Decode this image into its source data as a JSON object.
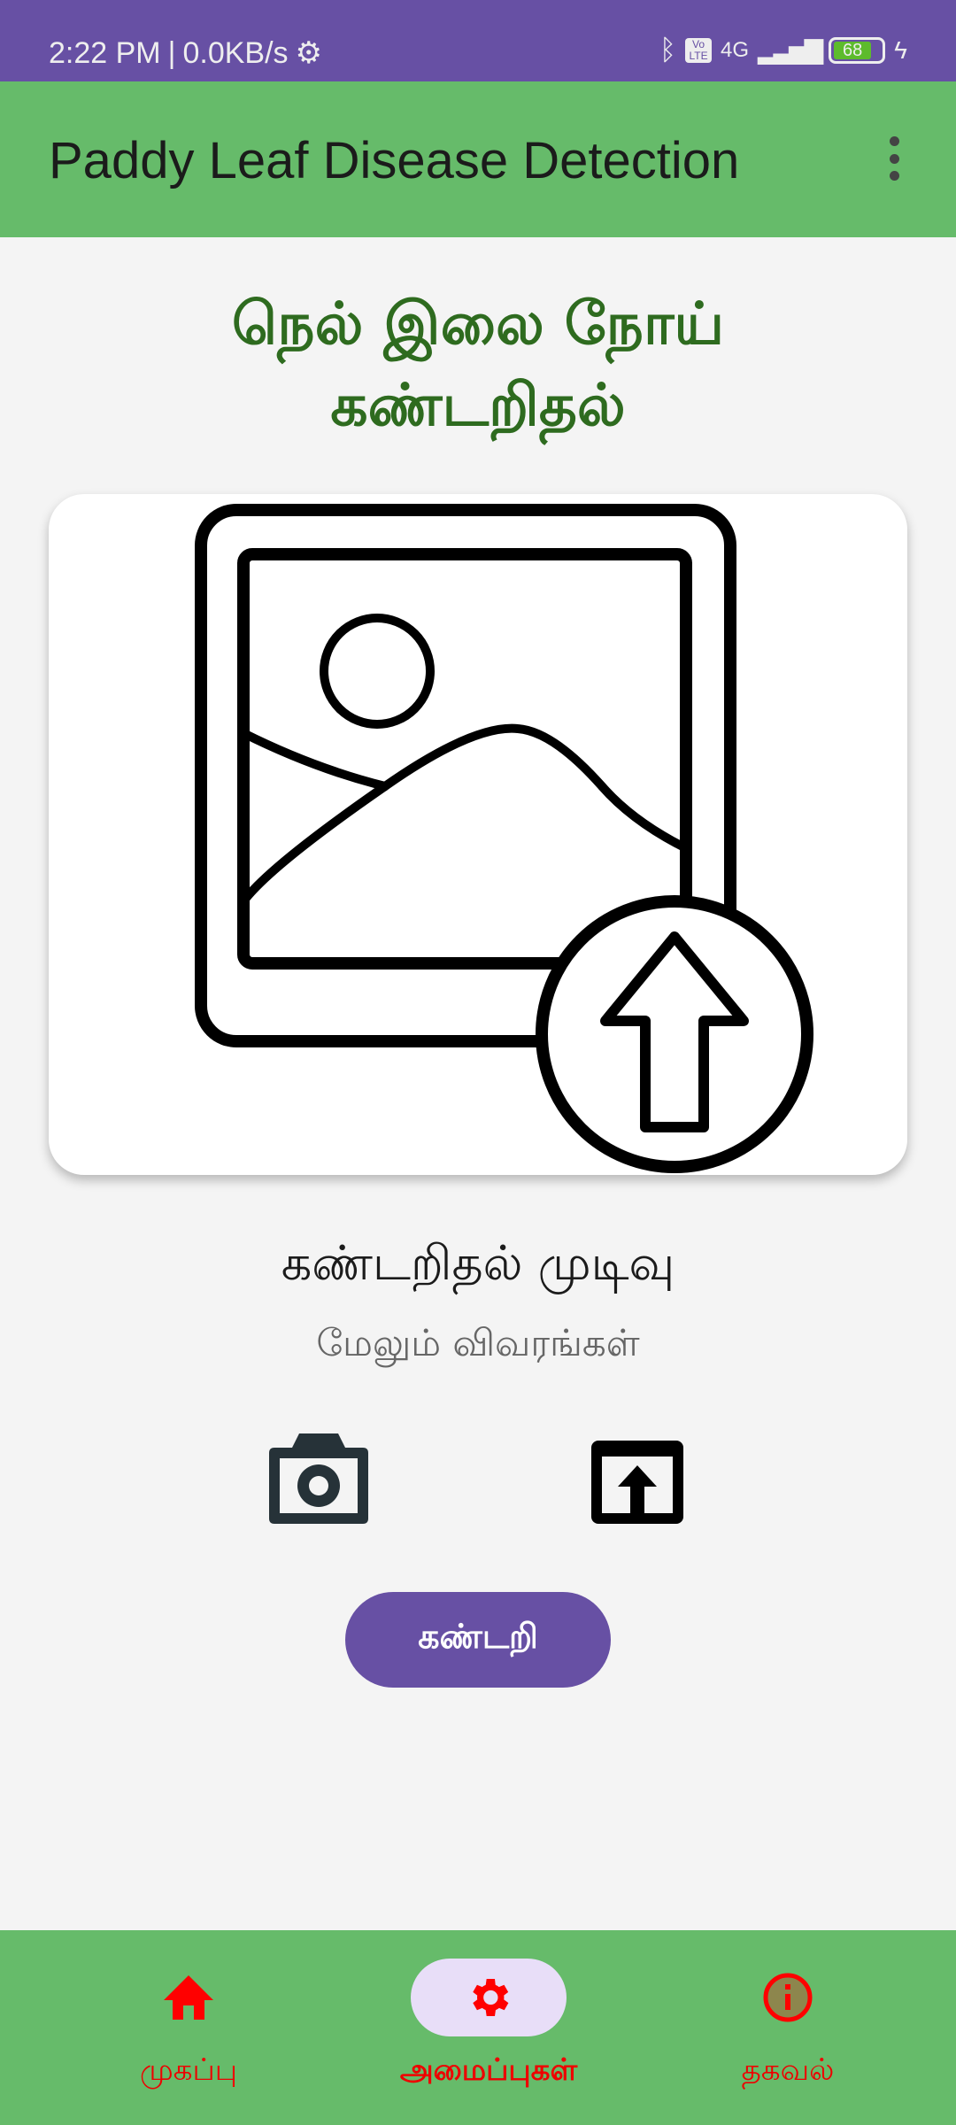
{
  "status_bar": {
    "time": "2:22 PM",
    "speed": "0.0KB/s",
    "network": "4G",
    "volte": "Vo LTE",
    "battery": "68"
  },
  "app_bar": {
    "title": "Paddy Leaf Disease Detection",
    "menu_icon": "more-vert-icon"
  },
  "main": {
    "heading_line1": "நெல் இலை நோய்",
    "heading_line2": "கண்டறிதல்",
    "image_placeholder_icon": "image-upload-icon",
    "result_title": "கண்டறிதல் முடிவு",
    "result_details": "மேலும் விவரங்கள்",
    "camera_icon": "camera-icon",
    "gallery_icon": "open-in-new-upload-icon",
    "detect_button": "கண்டறி"
  },
  "bottom_nav": {
    "items": [
      {
        "label": "முகப்பு",
        "icon": "home-icon",
        "active": false
      },
      {
        "label": "அமைப்புகள்",
        "icon": "gear-icon",
        "active": true
      },
      {
        "label": "தகவல்",
        "icon": "info-icon",
        "active": false
      }
    ]
  },
  "colors": {
    "primary": "#6750a4",
    "appbar": "#66bb6a",
    "heading": "#2e6b1f",
    "nav_label": "#ee0000"
  }
}
